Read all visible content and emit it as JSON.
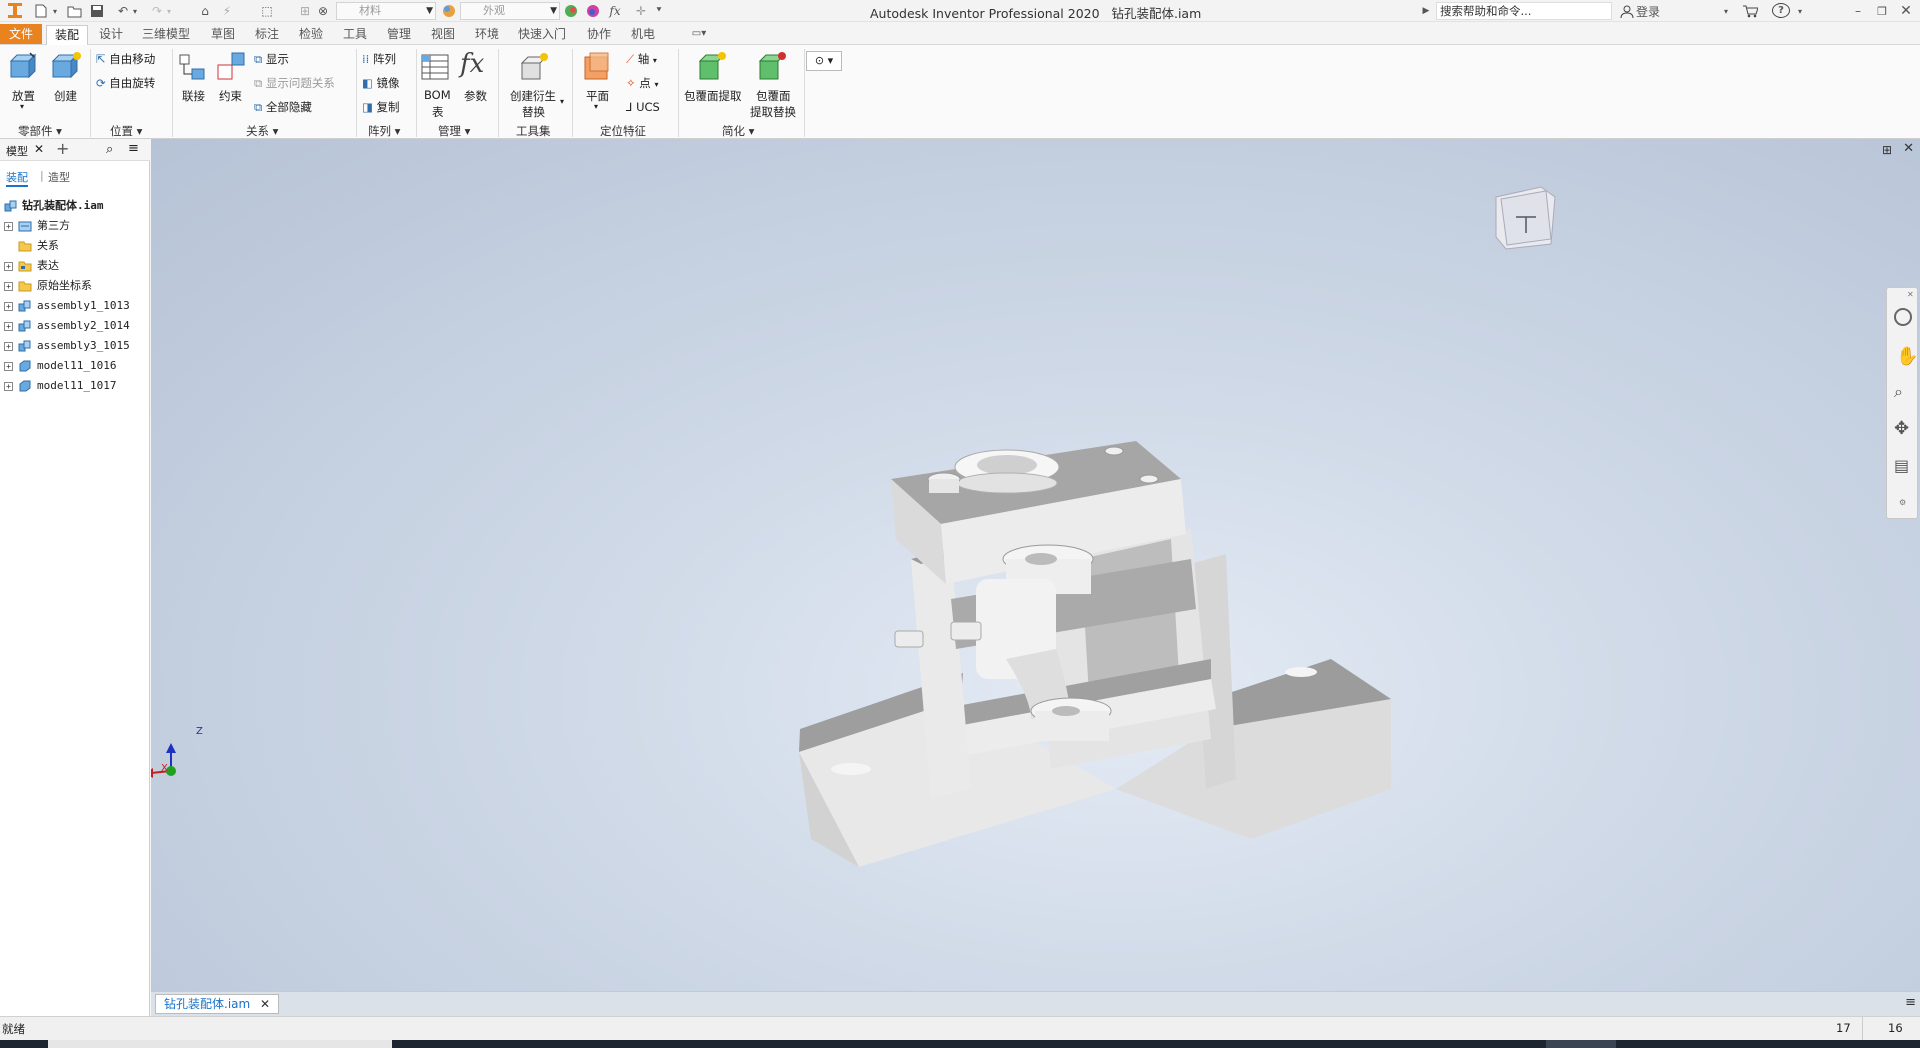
{
  "app": {
    "title": "Autodesk Inventor Professional 2020",
    "document": "钻孔装配体.iam",
    "search_placeholder": "搜索帮助和命令...",
    "login": "登录",
    "help": "?",
    "accent": "#e88320"
  },
  "quick_access": {
    "material_placeholder": "材料",
    "appearance_placeholder": "外观",
    "fx": "fx"
  },
  "menu_tabs": [
    "文件",
    "装配",
    "设计",
    "三维模型",
    "草图",
    "标注",
    "检验",
    "工具",
    "管理",
    "视图",
    "环境",
    "快速入门",
    "协作",
    "机电"
  ],
  "ribbon": {
    "place": "放置",
    "create": "创建",
    "free_move": "自由移动",
    "free_rotate": "自由旋转",
    "joint": "联接",
    "constrain": "约束",
    "show": "显示",
    "show_problem": "显示问题关系",
    "hide_all": "全部隐藏",
    "pattern": "阵列",
    "mirror": "镜像",
    "copy": "复制",
    "bom_line1": "BOM",
    "bom_line2": "表",
    "params": "参数",
    "derive_line1": "创建衍生",
    "derive_line2": "替换",
    "plane": "平面",
    "axis": "轴",
    "point": "点",
    "ucs": "UCS",
    "shrinkwrap": "包覆面提取",
    "shrinkwrap_sub_line1": "包覆面",
    "shrinkwrap_sub_line2": "提取替换",
    "groups": {
      "component": "零部件",
      "position": "位置",
      "relationships": "关系",
      "pattern": "阵列",
      "manage": "管理",
      "toolset": "工具集",
      "work_features": "定位特征",
      "simplification": "简化"
    }
  },
  "browser": {
    "title": "模型",
    "tab_assembly": "装配",
    "tab_modeling": "造型",
    "root": "钻孔装配体.iam",
    "items": [
      {
        "label": "第三方",
        "icon": "folder-link-icon",
        "expand": true
      },
      {
        "label": "关系",
        "icon": "folder-icon",
        "expand": false
      },
      {
        "label": "表达",
        "icon": "representations-icon",
        "expand": true
      },
      {
        "label": "原始坐标系",
        "icon": "folder-icon",
        "expand": true
      },
      {
        "label": "assembly1_1013",
        "icon": "assembly-icon",
        "expand": true
      },
      {
        "label": "assembly2_1014",
        "icon": "assembly-icon",
        "expand": true
      },
      {
        "label": "assembly3_1015",
        "icon": "assembly-icon",
        "expand": true
      },
      {
        "label": "model11_1016",
        "icon": "part-icon",
        "expand": true
      },
      {
        "label": "model11_1017",
        "icon": "part-icon",
        "expand": true
      }
    ]
  },
  "viewport": {
    "axis_x": "X",
    "axis_z": "Z"
  },
  "document_tab": "钻孔装配体.iam",
  "status": {
    "ready": "就绪",
    "count1": "17",
    "count2": "16"
  }
}
